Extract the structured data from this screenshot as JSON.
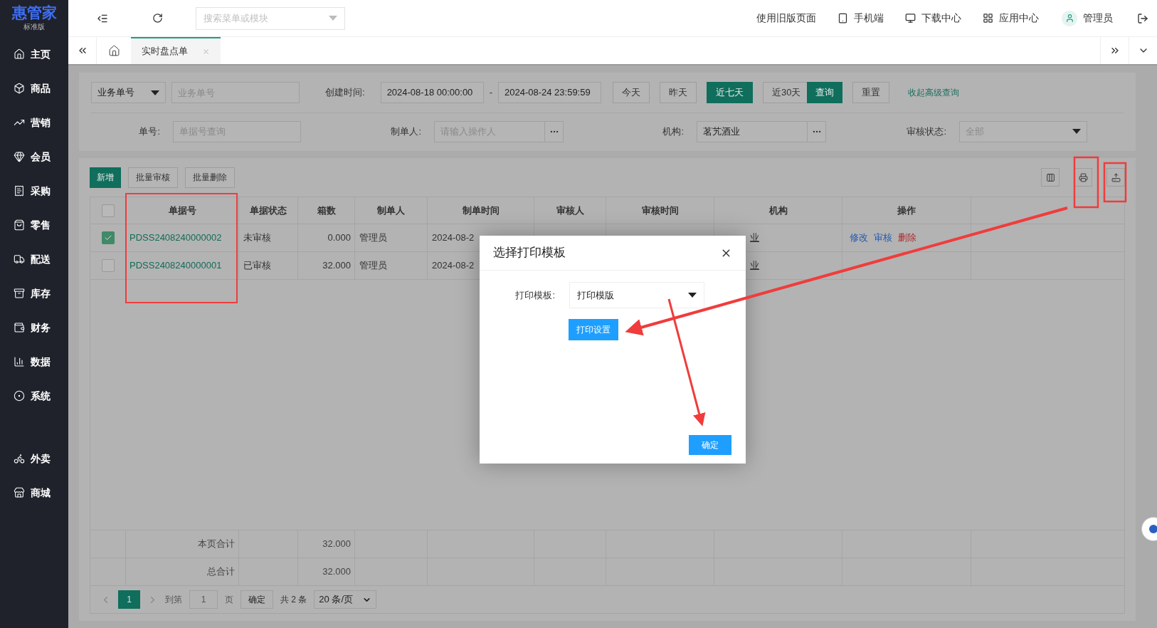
{
  "sidebar": {
    "logo": {
      "name": "惠管家",
      "edition": "标准版"
    },
    "items": [
      {
        "label": "主页"
      },
      {
        "label": "商品"
      },
      {
        "label": "营销"
      },
      {
        "label": "会员"
      },
      {
        "label": "采购"
      },
      {
        "label": "零售"
      },
      {
        "label": "配送"
      },
      {
        "label": "库存"
      },
      {
        "label": "财务"
      },
      {
        "label": "数据"
      },
      {
        "label": "系统"
      }
    ],
    "extra_items": [
      {
        "label": "外卖"
      },
      {
        "label": "商城"
      }
    ]
  },
  "topbar": {
    "search": {
      "placeholder": "搜索菜单或模块"
    },
    "links": [
      "使用旧版页面",
      "手机端",
      "下载中心",
      "应用中心"
    ],
    "user": "管理员"
  },
  "tabs": [
    {
      "label": "实时盘点单",
      "selected": true
    }
  ],
  "filters": {
    "type_select": "业务单号",
    "doc_placeholder": "业务单号",
    "created_label": "创建时间:",
    "start": "2024-08-18 00:00:00",
    "range_separator": "-",
    "end": "2024-08-24 23:59:59",
    "quick": [
      {
        "label": "今天",
        "selected": false
      },
      {
        "label": "昨天",
        "selected": false
      },
      {
        "label": "近七天",
        "selected": true
      },
      {
        "label": "近30天",
        "selected": false
      }
    ],
    "query": "查询",
    "reset": "重置",
    "collapse": "收起高级查询",
    "no_label": "单号:",
    "no_placeholder": "单据号查询",
    "maker_label": "制单人:",
    "maker_placeholder": "请输入操作人",
    "org_label": "机构:",
    "org_value": "茗艽酒业",
    "status_label": "审核状态:",
    "status_placeholder": "全部"
  },
  "toolbar": [
    {
      "label": "新增",
      "kind": "primary"
    },
    {
      "label": "批量审核",
      "kind": "plain"
    },
    {
      "label": "批量删除",
      "kind": "plain"
    }
  ],
  "table": {
    "select_all_checked": false,
    "columns": [
      "单据号",
      "单据状态",
      "箱数",
      "制单人",
      "制单时间",
      "审核人",
      "审核时间",
      "机构",
      "操作"
    ],
    "rows": [
      {
        "checked": true,
        "no": "PDSS2408240000002",
        "status": "未审核",
        "boxes": "0.000",
        "maker": "管理员",
        "time": "2024-08-2",
        "org": "业",
        "actions": [
          {
            "label": "修改",
            "kind": "edit"
          },
          {
            "label": "审核",
            "kind": "edit"
          },
          {
            "label": "删除",
            "kind": "delete"
          }
        ]
      },
      {
        "checked": false,
        "no": "PDSS2408240000001",
        "status": "已审核",
        "boxes": "32.000",
        "maker": "管理员",
        "time": "2024-08-2",
        "org": "业",
        "actions": []
      }
    ],
    "summary": [
      {
        "label": "本页合计",
        "boxes": "32.000"
      },
      {
        "label": "总合计",
        "boxes": "32.000"
      }
    ]
  },
  "pagination": {
    "pages": [
      {
        "label": "1",
        "selected": true
      }
    ],
    "goto": "到第",
    "goto_value": "1",
    "page_unit": "页",
    "confirm": "确定",
    "total": "共 2 条",
    "page_size": "20 条/页"
  },
  "dialog": {
    "title": "选择打印模板",
    "template_label": "打印模板:",
    "template_value": "打印模版",
    "settings_button": "打印设置",
    "ok_button": "确定"
  }
}
